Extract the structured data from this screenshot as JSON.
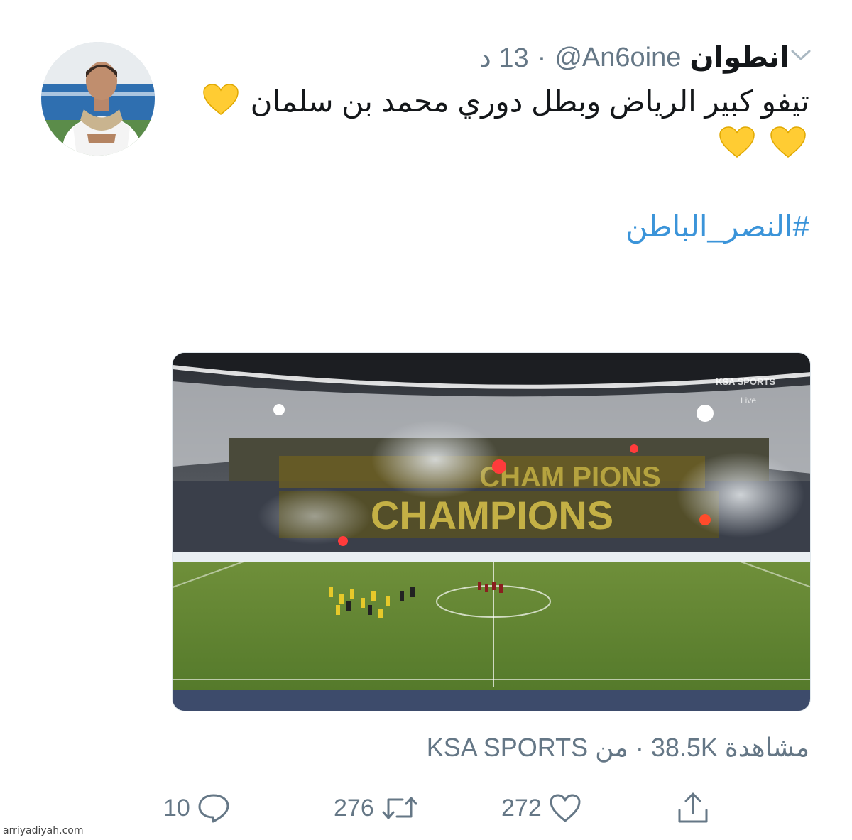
{
  "tweet": {
    "display_name": "انطوان",
    "handle": "@An6oine",
    "separator": "·",
    "time": "13 د",
    "text_line1": "تيفو كبير الرياض وبطل دوري محمد بن سلمان",
    "hashtag": "#النصر_الباطن",
    "heart_emoji": "yellow-heart-icon"
  },
  "media": {
    "broadcaster_logo": "KSA SPORTS",
    "live_label": "Live",
    "tifo_text_top": "CHAM PIONS",
    "tifo_text_bottom": "CHAMPIONS"
  },
  "views": {
    "label": "مشاهدة",
    "count": "38.5K",
    "separator": "·",
    "from_label": "من",
    "source": "KSA SPORTS"
  },
  "actions": {
    "replies": "10",
    "retweets": "276",
    "likes": "272"
  },
  "watermark": "arriyadiyah.com",
  "colors": {
    "link": "#3b94d9",
    "secondary_text": "#657786",
    "heart_emoji": "#ffcc33"
  }
}
